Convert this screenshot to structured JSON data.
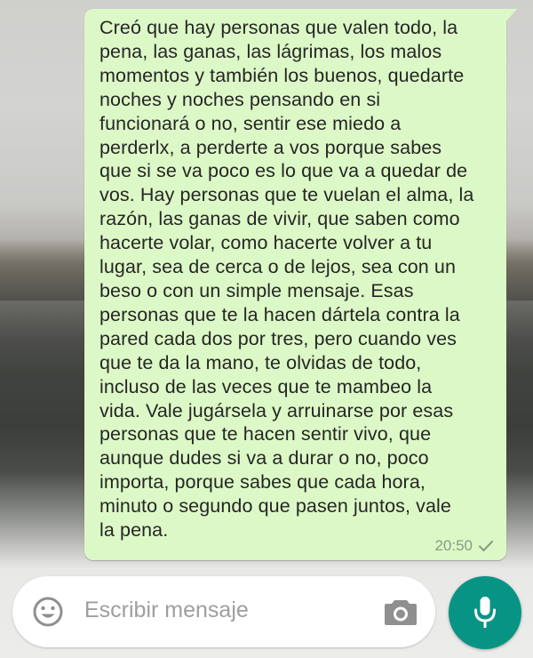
{
  "message": {
    "text": "Creó que hay personas que valen todo, la\npena, las ganas, las lágrimas, los malos\nmomentos y también los buenos, quedarte\nnoches y noches pensando en si\nfuncionará o no, sentir ese miedo a\nperderlx, a perderte a vos porque sabes\nque si se va poco es lo que va a quedar de\nvos. Hay personas que te vuelan el alma, la\nrazón, las ganas de vivir, que saben como\nhacerte volar, como hacerte volver a tu\nlugar, sea de cerca o de lejos, sea con un\nbeso o con un simple mensaje. Esas\npersonas que te la hacen dártela contra la\npared cada dos por tres, pero cuando ves\nque te da la mano, te olvidas de todo,\nincluso de las veces que te mambeo la\nvida. Vale jugársela y arruinarse por esas\npersonas que te hacen sentir vivo, que\naunque dudes si va a durar o no, poco\nimporta, porque sabes que cada hora,\nminuto o segundo que pasen juntos, vale\nla pena.",
    "time": "20:50",
    "status_icon": "single-check-icon"
  },
  "composer": {
    "placeholder": "Escribir mensaje",
    "emoji_icon": "emoji-icon",
    "camera_icon": "camera-icon",
    "send_icon": "microphone-icon"
  },
  "colors": {
    "bubble": "#dcf8c6",
    "accent": "#079485",
    "placeholder": "#9e9e9e"
  }
}
